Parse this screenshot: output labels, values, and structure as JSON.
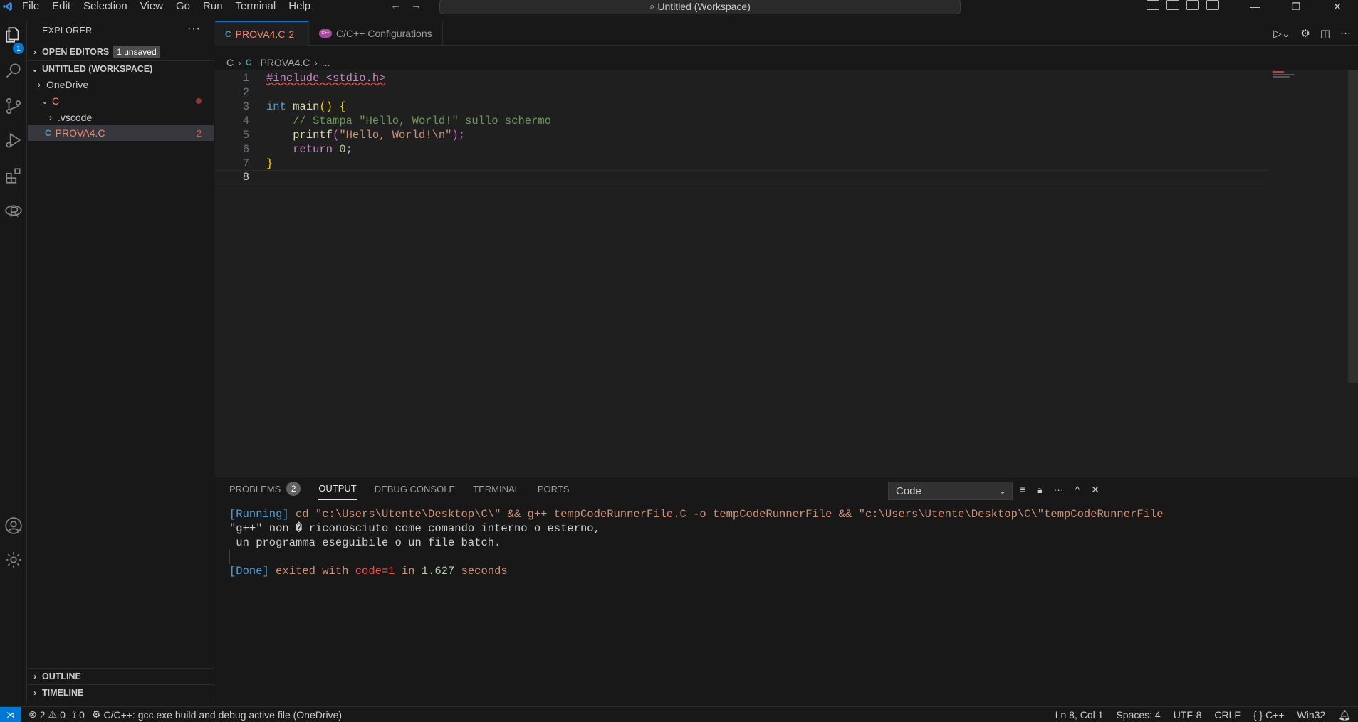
{
  "menu": [
    "File",
    "Edit",
    "Selection",
    "View",
    "Go",
    "Run",
    "Terminal",
    "Help"
  ],
  "command_center": "Untitled (Workspace)",
  "activity": {
    "explorer_badge": "1"
  },
  "explorer": {
    "title": "EXPLORER",
    "open_editors": "OPEN EDITORS",
    "unsaved_badge": "1 unsaved",
    "workspace": "UNTITLED (WORKSPACE)",
    "items": [
      {
        "label": "OneDrive"
      },
      {
        "label": "C"
      },
      {
        "label": ".vscode"
      },
      {
        "label": "PROVA4.C",
        "errors": "2"
      }
    ],
    "outline": "OUTLINE",
    "timeline": "TIMELINE"
  },
  "tabs": [
    {
      "label": "PROVA4.C",
      "errors": "2"
    },
    {
      "label": "C/C++ Configurations"
    }
  ],
  "breadcrumb": {
    "folder": "C",
    "file": "PROVA4.C",
    "rest": "..."
  },
  "code": {
    "line_numbers": [
      "1",
      "2",
      "3",
      "4",
      "5",
      "6",
      "7",
      "8"
    ],
    "l1": "#include <stdio.h>",
    "l3_type": "int",
    "l3_fn": "main",
    "l3_paren": "()",
    "l3_brace": "{",
    "l4": "// Stampa \"Hello, World!\" sullo schermo",
    "l5_fn": "printf",
    "l5_open": "(",
    "l5_str": "\"Hello, World!\\n\"",
    "l5_close": ");",
    "l6_kw": "return",
    "l6_num": "0",
    "l6_semi": ";",
    "l7": "}"
  },
  "panel": {
    "tabs": [
      "PROBLEMS",
      "OUTPUT",
      "DEBUG CONSOLE",
      "TERMINAL",
      "PORTS"
    ],
    "problems_count": "2",
    "select_value": "Code",
    "out_running": "[Running]",
    "out_cmd": " cd \"c:\\Users\\Utente\\Desktop\\C\\\" && g++ tempCodeRunnerFile.C -o tempCodeRunnerFile && \"c:\\Users\\Utente\\Desktop\\C\\\"tempCodeRunnerFile",
    "out_line2": "\"g++\" non � riconosciuto come comando interno o esterno,",
    "out_line3": " un programma eseguibile o un file batch.",
    "out_done": "[Done]",
    "out_exited": " exited with ",
    "out_code": "code=1",
    "out_in": " in ",
    "out_secs": "1.627",
    "out_seconds": " seconds"
  },
  "status": {
    "errors": "2",
    "warnings": "0",
    "ports": "0",
    "build": "C/C++: gcc.exe build and debug active file (OneDrive)",
    "position": "Ln 8, Col 1",
    "spaces": "Spaces: 4",
    "encoding": "UTF-8",
    "eol": "CRLF",
    "language": "C++",
    "platform": "Win32"
  },
  "colors": {
    "accent": "#0078d4",
    "error": "#f14c4c"
  }
}
